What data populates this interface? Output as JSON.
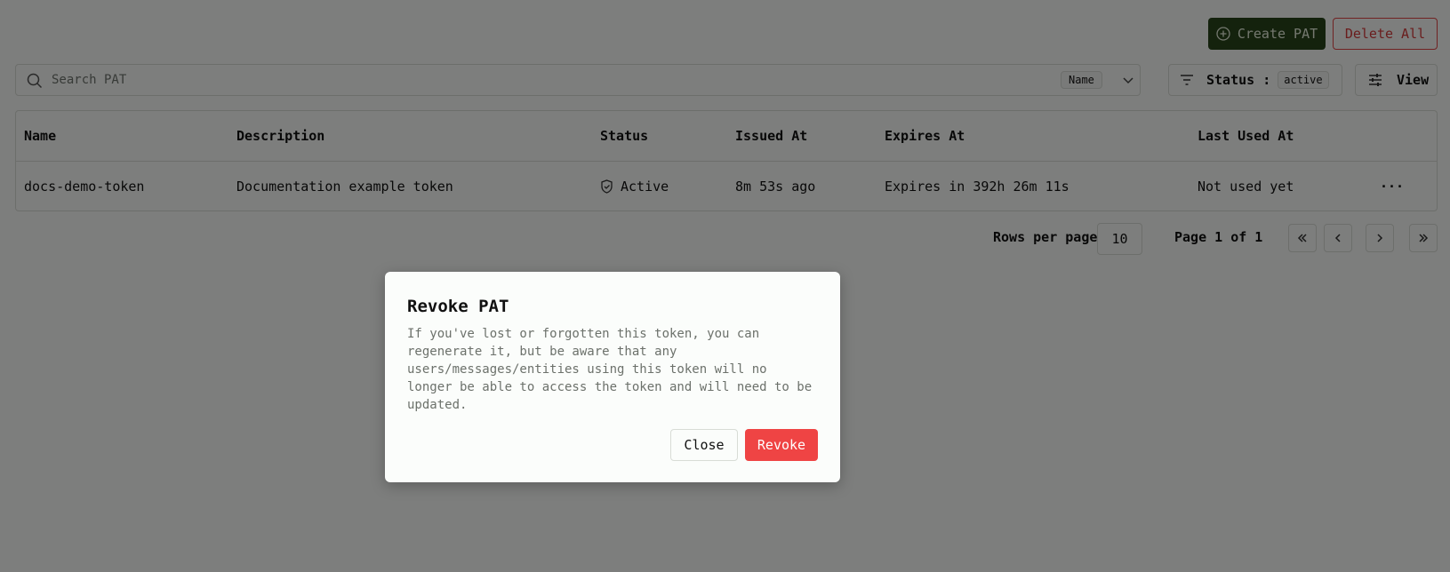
{
  "toolbar": {
    "create_label": "Create PAT",
    "delete_all_label": "Delete All"
  },
  "search": {
    "placeholder": "Search PAT",
    "field_tag": "Name"
  },
  "filter": {
    "status_label": "Status :",
    "status_value": "active",
    "view_label": "View"
  },
  "table": {
    "columns": [
      "Name",
      "Description",
      "Status",
      "Issued At",
      "Expires At",
      "Last Used At"
    ],
    "rows": [
      {
        "name": "docs-demo-token",
        "description": "Documentation example token",
        "status": "Active",
        "issued_at": "8m 53s ago",
        "expires_at": "Expires in 392h 26m 11s",
        "last_used_at": "Not used yet",
        "actions": "···"
      }
    ]
  },
  "pagination": {
    "rows_per_page_label": "Rows per page",
    "rows_per_page_value": "10",
    "page_label": "Page 1 of 1"
  },
  "modal": {
    "title": "Revoke PAT",
    "body": "If you've lost or forgotten this token, you can regenerate it, but be aware that any users/messages/entities using this token will no longer be able to access the token and will need to be updated.",
    "close_label": "Close",
    "revoke_label": "Revoke"
  },
  "colors": {
    "create_button": "#28441a",
    "delete_button": "#d43a3a",
    "revoke_button": "#ef4444"
  }
}
